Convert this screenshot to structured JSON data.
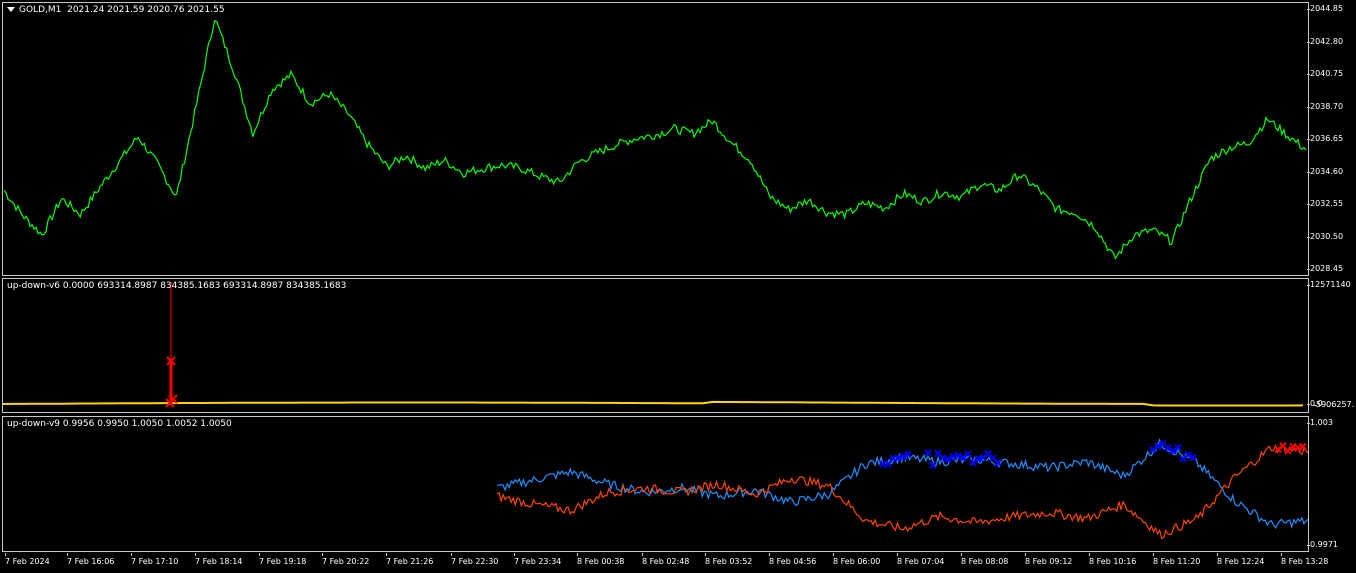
{
  "main_pane": {
    "symbol_label": "GOLD,M1",
    "ohlc": "2021.24 2021.59 2020.76 2021.55",
    "y_ticks": [
      "2044.85",
      "2042.80",
      "2040.75",
      "2038.70",
      "2036.65",
      "2034.60",
      "2032.55",
      "2030.50",
      "2028.45"
    ]
  },
  "v6_pane": {
    "label": "up-down-v6 0.0000 693314.8987 834385.1683 693314.8987 834385.1683",
    "y_top": "12571140",
    "y_bottom": "0.0",
    "y_mid": "5906257."
  },
  "v9_pane": {
    "label": "up-down-v9 0.9956 0.9950 1.0050 1.0052 1.0050",
    "y_top": "1.003",
    "y_bottom": "0.9971"
  },
  "x_ticks": [
    "7 Feb 2024",
    "7 Feb 16:06",
    "7 Feb 17:10",
    "7 Feb 18:14",
    "7 Feb 19:18",
    "7 Feb 20:22",
    "7 Feb 21:26",
    "7 Feb 22:30",
    "7 Feb 23:34",
    "8 Feb 00:38",
    "8 Feb 02:48",
    "8 Feb 03:52",
    "8 Feb 04:56",
    "8 Feb 06:00",
    "8 Feb 07:04",
    "8 Feb 08:08",
    "8 Feb 09:12",
    "8 Feb 10:16",
    "8 Feb 11:20",
    "8 Feb 12:24",
    "8 Feb 13:28"
  ],
  "colors": {
    "price": "#00ff00",
    "v9_up": "#1e90ff",
    "v9_down": "#ff4500",
    "v6_line": "#ffd700",
    "marker_red": "#ff0000",
    "marker_blue": "#0000ff",
    "frame": "#c8c8c8"
  },
  "chart_data": [
    {
      "type": "line",
      "series": [
        {
          "name": "GOLD,M1",
          "values": [
            2033.4,
            2031.8,
            2030.6,
            2032.9,
            2031.9,
            2033.6,
            2035.2,
            2036.8,
            2035.1,
            2033.0,
            2038.5,
            2044.3,
            2041.0,
            2037.0,
            2039.8,
            2040.7,
            2038.9,
            2039.5,
            2038.2,
            2036.3,
            2034.9,
            2035.6,
            2034.8,
            2035.3,
            2034.5,
            2034.8,
            2035.0,
            2034.8,
            2034.3,
            2033.9,
            2035.2,
            2035.8,
            2036.3,
            2036.7,
            2036.9,
            2037.3,
            2037.0,
            2037.8,
            2036.4,
            2035.3,
            2033.0,
            2032.2,
            2032.8,
            2032.0,
            2031.9,
            2032.6,
            2032.3,
            2033.2,
            2032.7,
            2033.3,
            2033.0,
            2033.8,
            2033.4,
            2034.4,
            2033.5,
            2032.2,
            2032.0,
            2031.1,
            2029.1,
            2030.6,
            2030.9,
            2030.2,
            2032.9,
            2035.4,
            2036.1,
            2036.4,
            2037.9,
            2036.9,
            2036.0
          ]
        }
      ],
      "ylim": [
        2028.45,
        2044.85
      ]
    },
    {
      "type": "line",
      "series": [
        {
          "name": "up-down-v6",
          "values": [
            693314.8987,
            693314.8987,
            834385.1683,
            12571140,
            834385.1683,
            693314.8987
          ]
        }
      ],
      "ylim": [
        0,
        12571140
      ]
    },
    {
      "type": "line",
      "series": [
        {
          "name": "up",
          "values": [
            0.9998,
            1.0002,
            1.0006,
            1.0,
            0.9996,
            0.9998,
            0.9994,
            0.9997,
            0.9991,
            0.9995,
            1.001,
            1.0013,
            1.0011,
            1.0012,
            1.001,
            1.0008,
            1.0011,
            1.0004,
            1.002,
            1.001,
            0.9992,
            0.998,
            0.9982
          ]
        },
        {
          "name": "down",
          "values": [
            0.9994,
            0.999,
            0.9987,
            0.9996,
            0.9998,
            0.9996,
            1.0,
            0.9995,
            1.0003,
            0.9999,
            0.9982,
            0.9978,
            0.9984,
            0.9981,
            0.9984,
            0.9986,
            0.9983,
            0.999,
            0.9975,
            0.9983,
            1.0003,
            1.0018,
            1.0016
          ]
        }
      ],
      "ylim": [
        0.9971,
        1.003
      ]
    }
  ]
}
